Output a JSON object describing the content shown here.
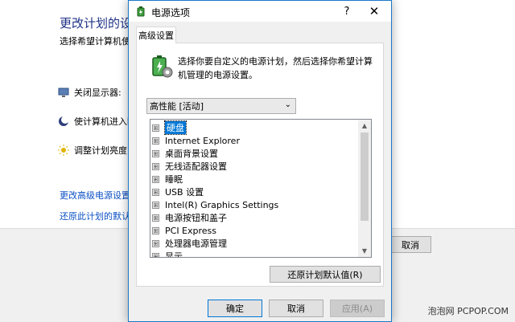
{
  "background": {
    "title": "更改计划的设置",
    "subtitle": "选择希望计算机使用",
    "rows": [
      {
        "label": "关闭显示器:"
      },
      {
        "label": "使计算机进入睡"
      },
      {
        "label": "调整计划亮度:"
      }
    ],
    "links": [
      "更改高级电源设置(C",
      "还原此计划的默认设"
    ],
    "cancel_label": "取消"
  },
  "watermark": "泡泡网 PCPOP.COM",
  "dialog": {
    "title": "电源选项",
    "help_symbol": "?",
    "close_symbol": "✕",
    "tab_label": "高级设置",
    "description": "选择你要自定义的电源计划，然后选择你希望计算机管理的电源设置。",
    "plan_select": "高性能 [活动]",
    "tree_items": [
      {
        "label": "硬盘",
        "selected": true
      },
      {
        "label": "Internet Explorer"
      },
      {
        "label": "桌面背景设置"
      },
      {
        "label": "无线适配器设置"
      },
      {
        "label": "睡眠"
      },
      {
        "label": "USB 设置"
      },
      {
        "label": "Intel(R) Graphics Settings"
      },
      {
        "label": "电源按钮和盖子"
      },
      {
        "label": "PCI Express"
      },
      {
        "label": "处理器电源管理"
      },
      {
        "label": "显示"
      }
    ],
    "expander_symbol": "⊞",
    "restore_label": "还原计划默认值(R)",
    "buttons": {
      "ok": "确定",
      "cancel": "取消",
      "apply": "应用(A)"
    }
  },
  "colors": {
    "accent": "#0078d7",
    "title_blue": "#1e3287",
    "link_blue": "#0a4fc4"
  }
}
